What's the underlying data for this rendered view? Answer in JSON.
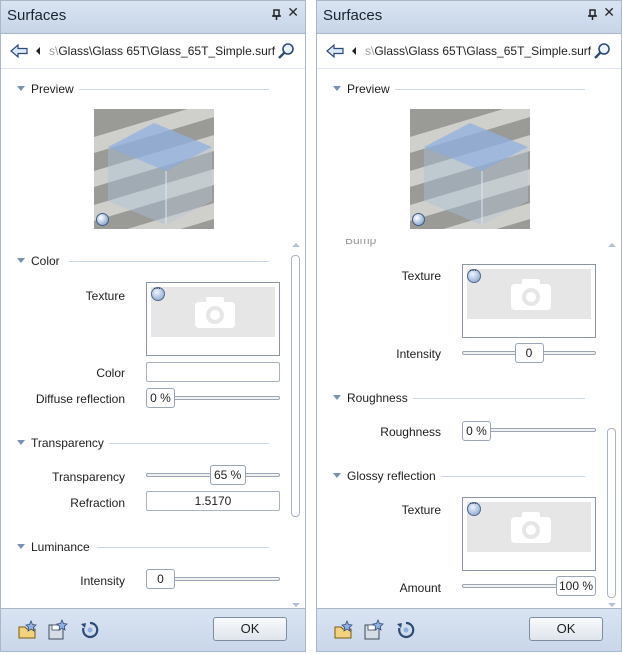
{
  "left_panel": {
    "title": "Surfaces",
    "path_prefix": "s\\",
    "path": "Glass\\Glass 65T\\Glass_65T_Simple.surf",
    "preview_section": "Preview",
    "color_section": "Color",
    "texture_label": "Texture",
    "color_label": "Color",
    "color_value": "",
    "diffuse_label": "Diffuse reflection",
    "diffuse_value": "0 %",
    "transparency_section": "Transparency",
    "transparency_label": "Transparency",
    "transparency_value": "65 %",
    "transparency_level": 0.65,
    "refraction_label": "Refraction",
    "refraction_value": "1.5170",
    "luminance_section": "Luminance",
    "intensity_label": "Intensity",
    "intensity_value": "0",
    "ok_label": "OK"
  },
  "right_panel": {
    "title": "Surfaces",
    "path_prefix": "s\\",
    "path": "Glass\\Glass 65T\\Glass_65T_Simple.surf",
    "preview_section": "Preview",
    "bump_partial": "Bump",
    "texture_label": "Texture",
    "intensity_label": "Intensity",
    "intensity_value": "0",
    "intensity_level": 0.5,
    "roughness_section": "Roughness",
    "roughness_label": "Roughness",
    "roughness_value": "0 %",
    "glossy_section": "Glossy reflection",
    "glossy_texture_label": "Texture",
    "amount_label": "Amount",
    "amount_value": "100 %",
    "amount_level": 1.0,
    "ok_label": "OK"
  },
  "icons": {
    "back": "back-arrow-icon",
    "history": "history-dropdown-icon",
    "search": "search-icon",
    "pin": "pin-icon",
    "close": "close-icon",
    "open_favorite": "open-favorite-icon",
    "save_favorite": "save-favorite-icon",
    "reset": "reset-icon",
    "texture_more": "more-options-icon",
    "preview_sphere": "preview-mode-icon"
  },
  "colors": {
    "titlebar": "#d2deee",
    "accent": "#7a93b3",
    "glass": "#8fb0e0"
  }
}
